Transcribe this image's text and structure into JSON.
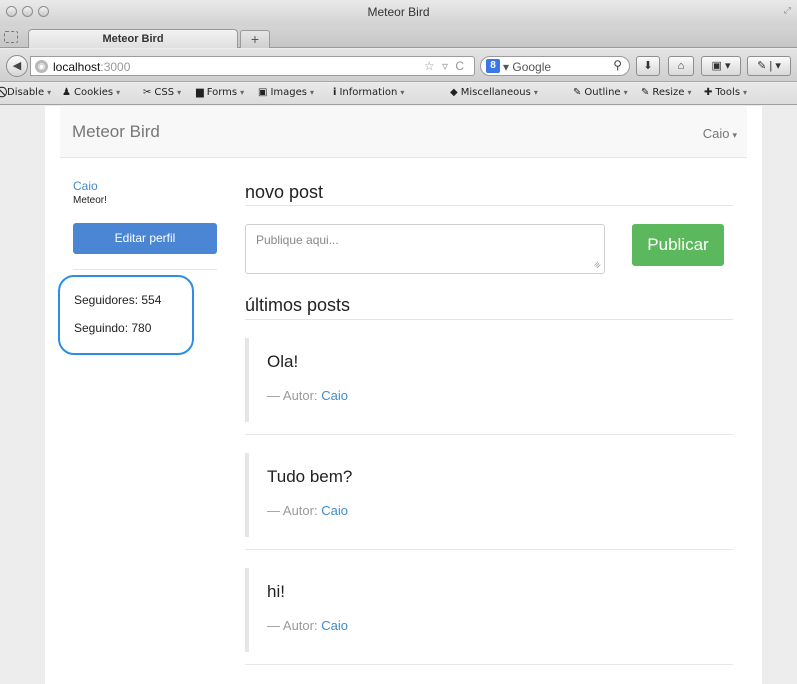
{
  "window": {
    "title": "Meteor Bird"
  },
  "tab": {
    "label": "Meteor Bird",
    "new_tab_label": "+"
  },
  "urlbar": {
    "host": "localhost",
    "port": ":3000",
    "icons": "☆ ▿ C"
  },
  "searchbar": {
    "engine_badge": "8",
    "engine": "▾ Google",
    "icon": "search-icon"
  },
  "bookmarks": [
    {
      "glyph": "⃠",
      "label": "Disable"
    },
    {
      "glyph": "♟",
      "label": "Cookies"
    },
    {
      "glyph": "✂",
      "label": "CSS"
    },
    {
      "glyph": "▆",
      "label": "Forms"
    },
    {
      "glyph": "▣",
      "label": "Images"
    },
    {
      "glyph": "i",
      "label": "Information"
    },
    {
      "glyph": "◆",
      "label": "Miscellaneous"
    },
    {
      "glyph": "✎",
      "label": "Outline"
    },
    {
      "glyph": "✎",
      "label": "Resize"
    },
    {
      "glyph": "✚",
      "label": "Tools"
    }
  ],
  "app": {
    "brand": "Meteor Bird",
    "user_menu": "Caio",
    "sidebar": {
      "name": "Caio",
      "bio": "Meteor!",
      "edit_button": "Editar perfil",
      "followers": "Seguidores: 554",
      "following": "Seguindo: 780"
    },
    "new_post": {
      "heading": "novo post",
      "placeholder": "Publique aqui...",
      "publish_button": "Publicar"
    },
    "latest_heading": "últimos posts",
    "author_prefix": "— Autor: ",
    "posts": [
      {
        "text": "Ola!",
        "author": "Caio"
      },
      {
        "text": "Tudo bem?",
        "author": "Caio"
      },
      {
        "text": "hi!",
        "author": "Caio"
      }
    ]
  },
  "colors": {
    "link": "#428bca",
    "primary_button": "#4a86d4",
    "success_button": "#5cb85c",
    "highlight_outline": "#2c8ee5"
  }
}
